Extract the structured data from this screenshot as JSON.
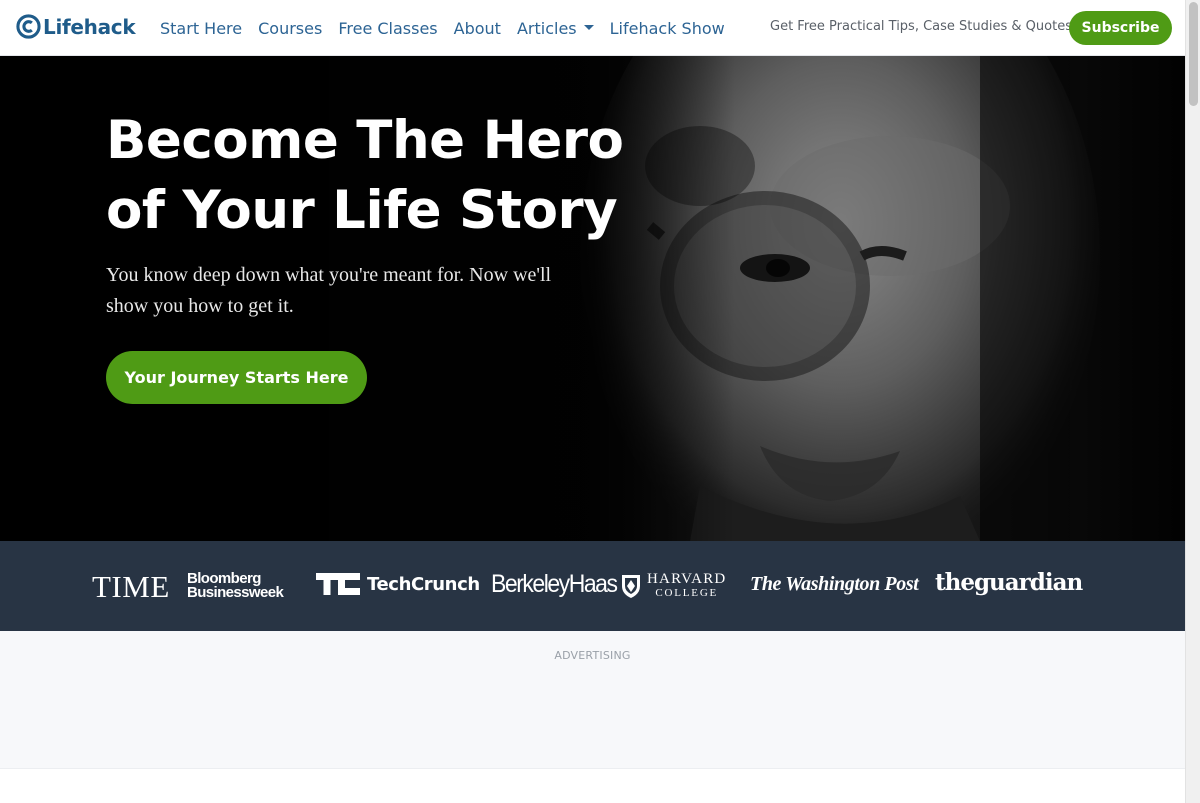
{
  "nav": {
    "logo_text": "Lifehack",
    "links": [
      {
        "label": "Start Here"
      },
      {
        "label": "Courses"
      },
      {
        "label": "Free Classes"
      },
      {
        "label": "About"
      },
      {
        "label": "Articles"
      },
      {
        "label": "Lifehack Show"
      }
    ],
    "tagline": "Get Free Practical Tips, Case Studies & Quotes",
    "subscribe_label": "Subscribe"
  },
  "hero": {
    "title_line1": "Become The Hero",
    "title_line2": "of Your Life Story",
    "subtitle": "You know deep down what you're meant for. Now we'll show you how to get it.",
    "cta_label": "Your Journey Starts Here"
  },
  "press": {
    "time": "TIME",
    "bloomberg_line1": "Bloomberg",
    "bloomberg_line2": "Businessweek",
    "techcrunch": "TechCrunch",
    "berkeley": "BerkeleyHaas",
    "harvard_line1": "HARVARD",
    "harvard_line2": "COLLEGE",
    "wapo": "The Washington Post",
    "guardian": "theguardian"
  },
  "ad": {
    "label": "ADVERTISING"
  },
  "colors": {
    "brand_blue": "#1f5c8a",
    "nav_link": "#2d6494",
    "accent_green": "#4f9b15",
    "press_bar": "#283444"
  }
}
